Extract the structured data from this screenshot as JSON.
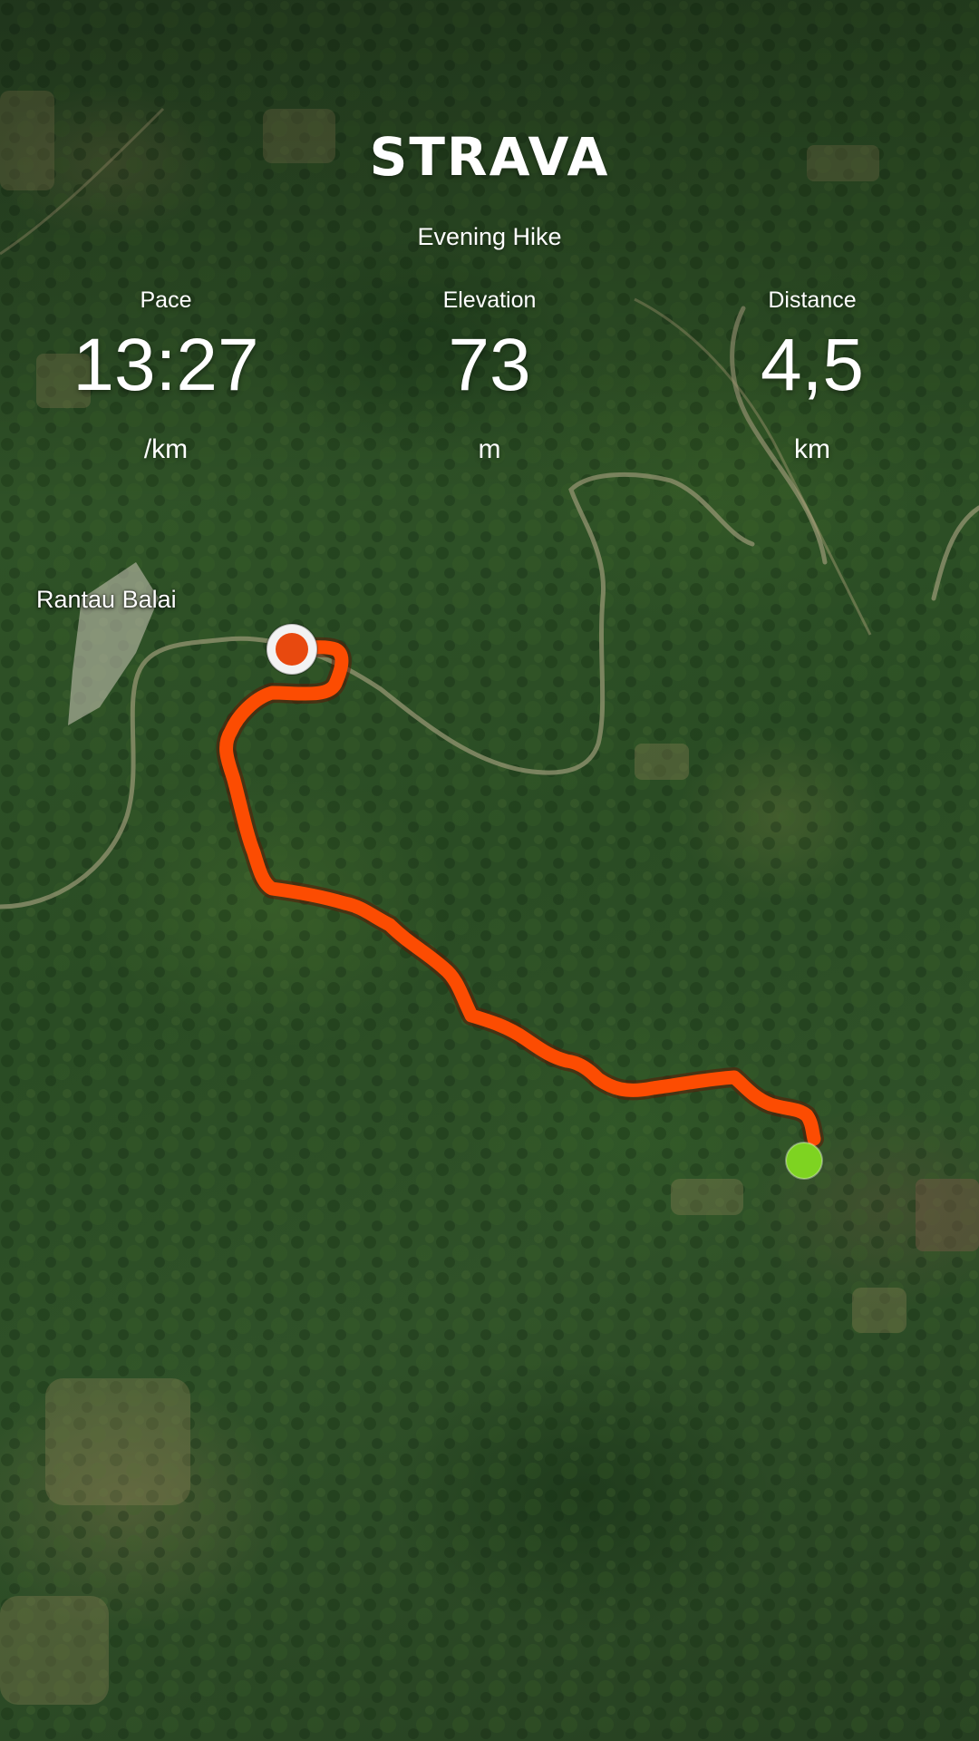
{
  "brand": {
    "logo_text": "STRAVA"
  },
  "activity": {
    "title": "Evening Hike"
  },
  "stats": {
    "pace": {
      "label": "Pace",
      "value": "13:27",
      "unit": "/km"
    },
    "elevation": {
      "label": "Elevation",
      "value": "73",
      "unit": "m"
    },
    "distance": {
      "label": "Distance",
      "value": "4,5",
      "unit": "km"
    }
  },
  "map": {
    "place_label": "Rantau Balai",
    "route_color": "#fc4c02",
    "start_marker_color": "#e8490f",
    "end_marker_color": "#7ed321"
  }
}
